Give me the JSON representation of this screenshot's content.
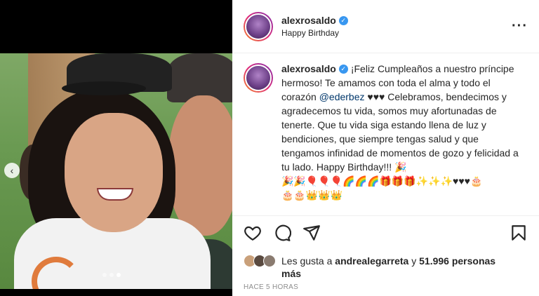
{
  "post": {
    "username": "alexrosaldo",
    "location_subtitle": "Happy Birthday",
    "caption_parts": {
      "before_mention": "¡Feliz Cumpleaños a nuestro príncipe hermoso! Te amamos con toda el alma y todo el corazón ",
      "mention": "@ederbez",
      "after_mention": " ♥♥♥ Celebramos, bendecimos y agradecemos tu vida, somos muy afortunadas de tenerte. Que tu vida siga estando llena de luz y bendiciones, que siempre tengas salud y que tengamos infinidad de momentos de gozo y felicidad a tu lado. Happy Birthday!!! 🎉",
      "emoji_line1": "🎉🎉🎈🎈🎈🌈🌈🌈🎁🎁🎁✨✨✨♥♥♥🎂",
      "emoji_line2": "🎂🎂👑👑👑"
    },
    "likes_prefix": "Les gusta a ",
    "likes_user": "andrealegarreta",
    "likes_middle": " y ",
    "likes_count": "51.996 personas",
    "likes_suffix": "más",
    "timestamp": "HACE 5 HORAS",
    "more_icon": "···",
    "carousel": {
      "total": 3,
      "active_index": 2
    }
  },
  "icons": {
    "verified": "verified-badge-icon",
    "like": "heart-icon",
    "comment": "comment-icon",
    "share": "share-icon",
    "save": "bookmark-icon",
    "prev": "chevron-left-icon"
  },
  "colors": {
    "verified": "#3897f0",
    "mention": "#00376b",
    "muted": "#8e8e8e"
  }
}
